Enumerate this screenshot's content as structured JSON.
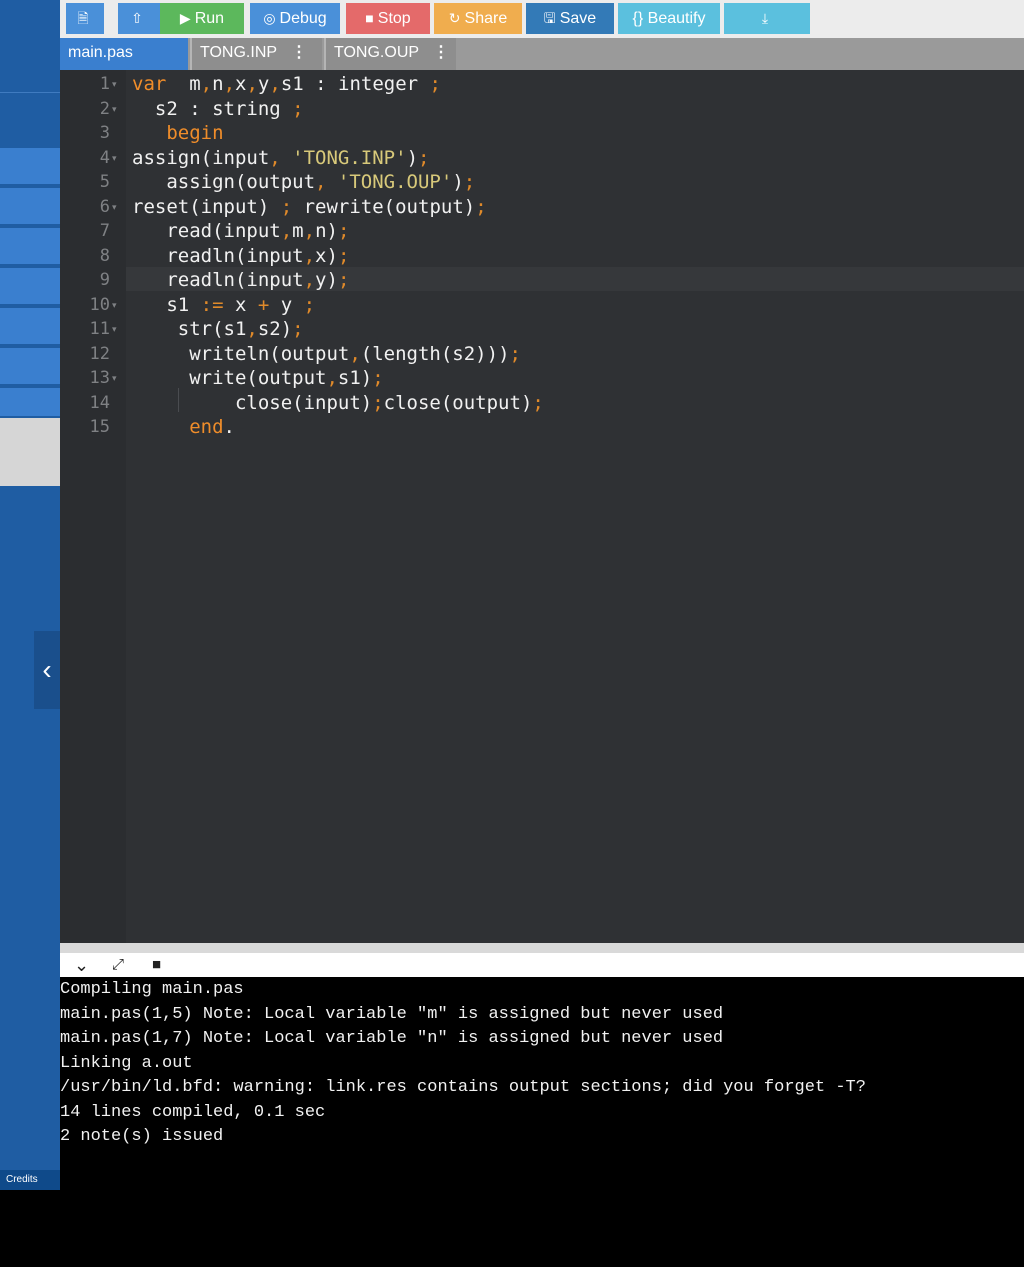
{
  "toolbar": {
    "buttons": [
      {
        "id": "new-file",
        "label": "",
        "icon": "file-icon",
        "color": "#4a90d9"
      },
      {
        "id": "upload",
        "label": "",
        "icon": "upload-icon",
        "color": "#4a90d9"
      },
      {
        "id": "run",
        "label": "Run",
        "icon": "play-icon",
        "color": "#5cb85c"
      },
      {
        "id": "debug",
        "label": "Debug",
        "icon": "debug-icon",
        "color": "#4a90d9"
      },
      {
        "id": "stop",
        "label": "Stop",
        "icon": "stop-icon",
        "color": "#e46a6a"
      },
      {
        "id": "share",
        "label": "Share",
        "icon": "share-icon",
        "color": "#f0ad4e"
      },
      {
        "id": "save",
        "label": "Save",
        "icon": "save-icon",
        "color": "#337ab7"
      },
      {
        "id": "beautify",
        "label": "{} Beautify",
        "icon": "",
        "color": "#5bc0de"
      },
      {
        "id": "download",
        "label": "",
        "icon": "download-icon",
        "color": "#5bc0de"
      }
    ]
  },
  "tabs": [
    {
      "label": "main.pas",
      "active": true
    },
    {
      "label": "TONG.INP",
      "active": false
    },
    {
      "label": "TONG.OUP",
      "active": false
    }
  ],
  "editor": {
    "line_numbers": [
      "1",
      "2",
      "3",
      "4",
      "5",
      "6",
      "7",
      "8",
      "9",
      "10",
      "11",
      "12",
      "13",
      "14",
      "15"
    ],
    "active_line": 9
  },
  "code_lines": [
    [
      [
        "kw",
        "var"
      ],
      [
        "",
        "  m"
      ],
      [
        "pn",
        ","
      ],
      [
        "",
        "n"
      ],
      [
        "pn",
        ","
      ],
      [
        "",
        "x"
      ],
      [
        "pn",
        ","
      ],
      [
        "",
        "y"
      ],
      [
        "pn",
        ","
      ],
      [
        "",
        "s1 : integer "
      ],
      [
        "pn",
        ";"
      ]
    ],
    [
      [
        "",
        "  s2 : string "
      ],
      [
        "pn",
        ";"
      ]
    ],
    [
      [
        "kw",
        "   begin"
      ]
    ],
    [
      [
        "",
        "assign(input"
      ],
      [
        "pn",
        ","
      ],
      [
        "st",
        " 'TONG.INP'"
      ],
      [
        "",
        ")"
      ],
      [
        "pn",
        ";"
      ]
    ],
    [
      [
        "",
        "   assign(output"
      ],
      [
        "pn",
        ","
      ],
      [
        "st",
        " 'TONG.OUP'"
      ],
      [
        "",
        ")"
      ],
      [
        "pn",
        ";"
      ]
    ],
    [
      [
        "",
        "reset(input) "
      ],
      [
        "pn",
        ";"
      ],
      [
        "",
        " rewrite(output)"
      ],
      [
        "pn",
        ";"
      ]
    ],
    [
      [
        "",
        "   read(input"
      ],
      [
        "pn",
        ","
      ],
      [
        "",
        "m"
      ],
      [
        "pn",
        ","
      ],
      [
        "",
        "n)"
      ],
      [
        "pn",
        ";"
      ]
    ],
    [
      [
        "",
        "   readln(input"
      ],
      [
        "pn",
        ","
      ],
      [
        "",
        "x)"
      ],
      [
        "pn",
        ";"
      ]
    ],
    [
      [
        "",
        "   readln(input"
      ],
      [
        "pn",
        ","
      ],
      [
        "",
        "y)"
      ],
      [
        "pn",
        ";"
      ]
    ],
    [
      [
        "",
        "   s1 "
      ],
      [
        "pn",
        ":="
      ],
      [
        "",
        " x "
      ],
      [
        "pn",
        "+"
      ],
      [
        "",
        " y "
      ],
      [
        "pn",
        ";"
      ]
    ],
    [
      [
        "",
        "    str(s1"
      ],
      [
        "pn",
        ","
      ],
      [
        "",
        "s2)"
      ],
      [
        "pn",
        ";"
      ]
    ],
    [
      [
        "",
        "     writeln(output"
      ],
      [
        "pn",
        ","
      ],
      [
        "",
        "(length(s2)))"
      ],
      [
        "pn",
        ";"
      ]
    ],
    [
      [
        "",
        "     write(output"
      ],
      [
        "pn",
        ","
      ],
      [
        "",
        "s1)"
      ],
      [
        "pn",
        ";"
      ]
    ],
    [
      [
        "",
        "         close(input)"
      ],
      [
        "pn",
        ";"
      ],
      [
        "",
        "close(output)"
      ],
      [
        "pn",
        ";"
      ]
    ],
    [
      [
        "kw",
        "     end"
      ],
      [
        "",
        "."
      ]
    ]
  ],
  "console": {
    "lines": [
      "Compiling main.pas",
      "main.pas(1,5) Note: Local variable \"m\" is assigned but never used",
      "main.pas(1,7) Note: Local variable \"n\" is assigned but never used",
      "Linking a.out",
      "/usr/bin/ld.bfd: warning: link.res contains output sections; did you forget -T?",
      "14 lines compiled, 0.1 sec",
      "2 note(s) issued"
    ]
  },
  "sidebar": {
    "credits_label": "Credits"
  }
}
